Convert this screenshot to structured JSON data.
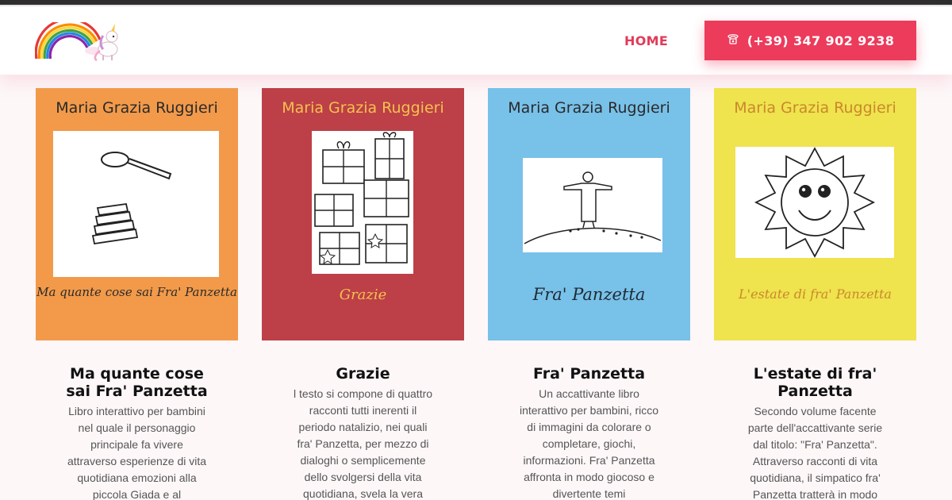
{
  "header": {
    "nav_home": "HOME",
    "phone": "(+39) 347 902 9238",
    "phone_icon": "phone-icon",
    "logo": "rainbow-unicorn-logo",
    "accent": "#ec3b5b"
  },
  "books": [
    {
      "author": "Maria Grazia Ruggieri",
      "cover_script": "Ma quante cose sai Fra' Panzetta",
      "cover_color": "#f29a4a",
      "title": "Ma quante cose sai Fra' Panzetta",
      "description": "Libro interattivo per bambini nel quale il personaggio principale fa vivere attraverso esperienze di vita quotidiana emozioni alla piccola Giada e al"
    },
    {
      "author": "Maria Grazia Ruggieri",
      "cover_script": "Grazie",
      "cover_color": "#bd3f47",
      "title": "Grazie",
      "description": "l testo si compone di quattro racconti tutti inerenti il periodo natalizio, nei quali fra' Panzetta, per mezzo di dialoghi o semplicemente dello svolgersi della vita quotidiana, svela la vera"
    },
    {
      "author": "Maria Grazia Ruggieri",
      "cover_script": "Fra' Panzetta",
      "cover_color": "#78c1e9",
      "title": "Fra' Panzetta",
      "description": "Un accattivante libro interattivo per bambini, ricco di immagini da colorare o completare, giochi, informazioni. Fra' Panzetta affronta in modo giocoso e divertente temi"
    },
    {
      "author": "Maria Grazia Ruggieri",
      "cover_script": "L'estate di fra' Panzetta",
      "cover_color": "#efe34e",
      "title": "L'estate di fra' Panzetta",
      "description": "Secondo volume facente parte dell'accattivante serie dal titolo: \"Fra' Panzetta\". Attraverso racconti di vita quotidiana, il simpatico fra' Panzetta tratterà in modo"
    }
  ]
}
